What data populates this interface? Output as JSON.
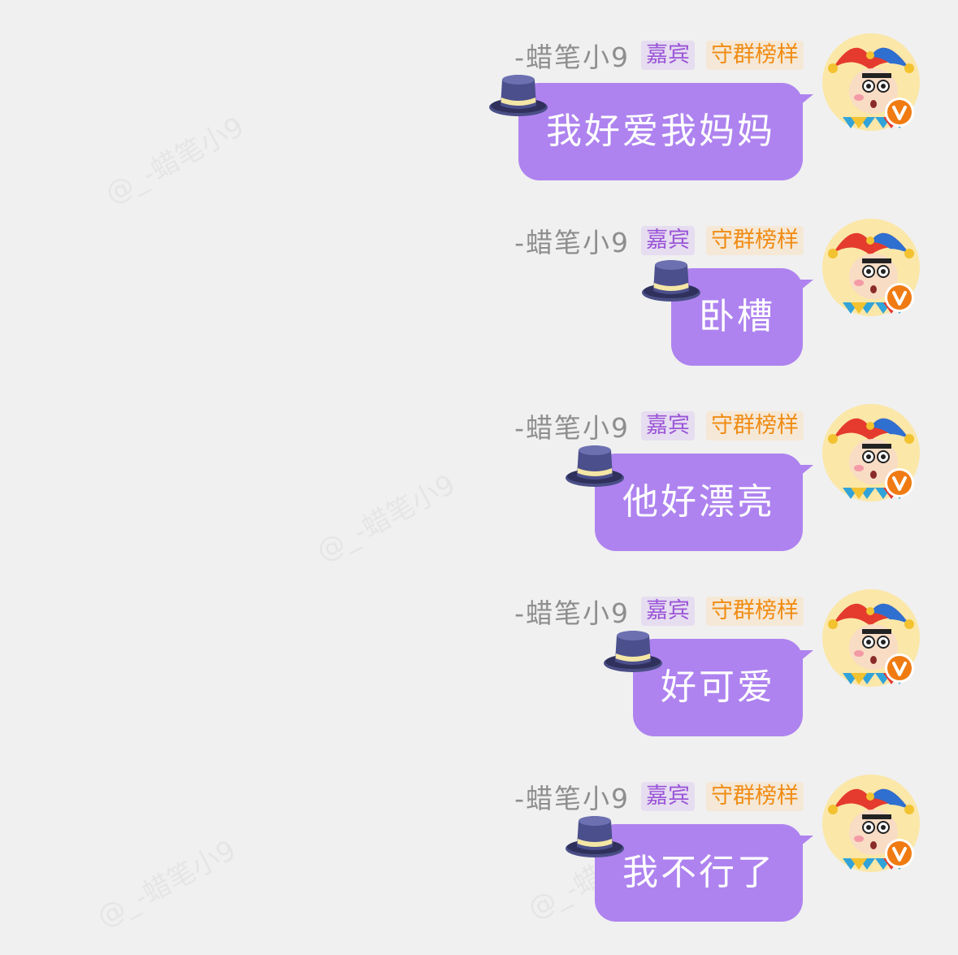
{
  "watermark": {
    "text": "@_-蜡笔小9"
  },
  "messages": [
    {
      "username": "-蜡笔小9",
      "badge_guest": "嘉宾",
      "badge_rank": "守群榜样",
      "text": "我好爱我妈妈"
    },
    {
      "username": "-蜡笔小9",
      "badge_guest": "嘉宾",
      "badge_rank": "守群榜样",
      "text": "卧槽"
    },
    {
      "username": "-蜡笔小9",
      "badge_guest": "嘉宾",
      "badge_rank": "守群榜样",
      "text": "他好漂亮"
    },
    {
      "username": "-蜡笔小9",
      "badge_guest": "嘉宾",
      "badge_rank": "守群榜样",
      "text": "好可爱"
    },
    {
      "username": "-蜡笔小9",
      "badge_guest": "嘉宾",
      "badge_rank": "守群榜样",
      "text": "我不行了"
    }
  ],
  "colors": {
    "background": "#f0f0f0",
    "bubble": "#ae83ef",
    "badge_guest_text": "#9b55d8",
    "badge_rank_text": "#f08c14"
  },
  "icons": {
    "avatar": "jester-cartoon-avatar",
    "verified": "orange-v-badge-icon",
    "decoration": "top-hat-icon"
  }
}
